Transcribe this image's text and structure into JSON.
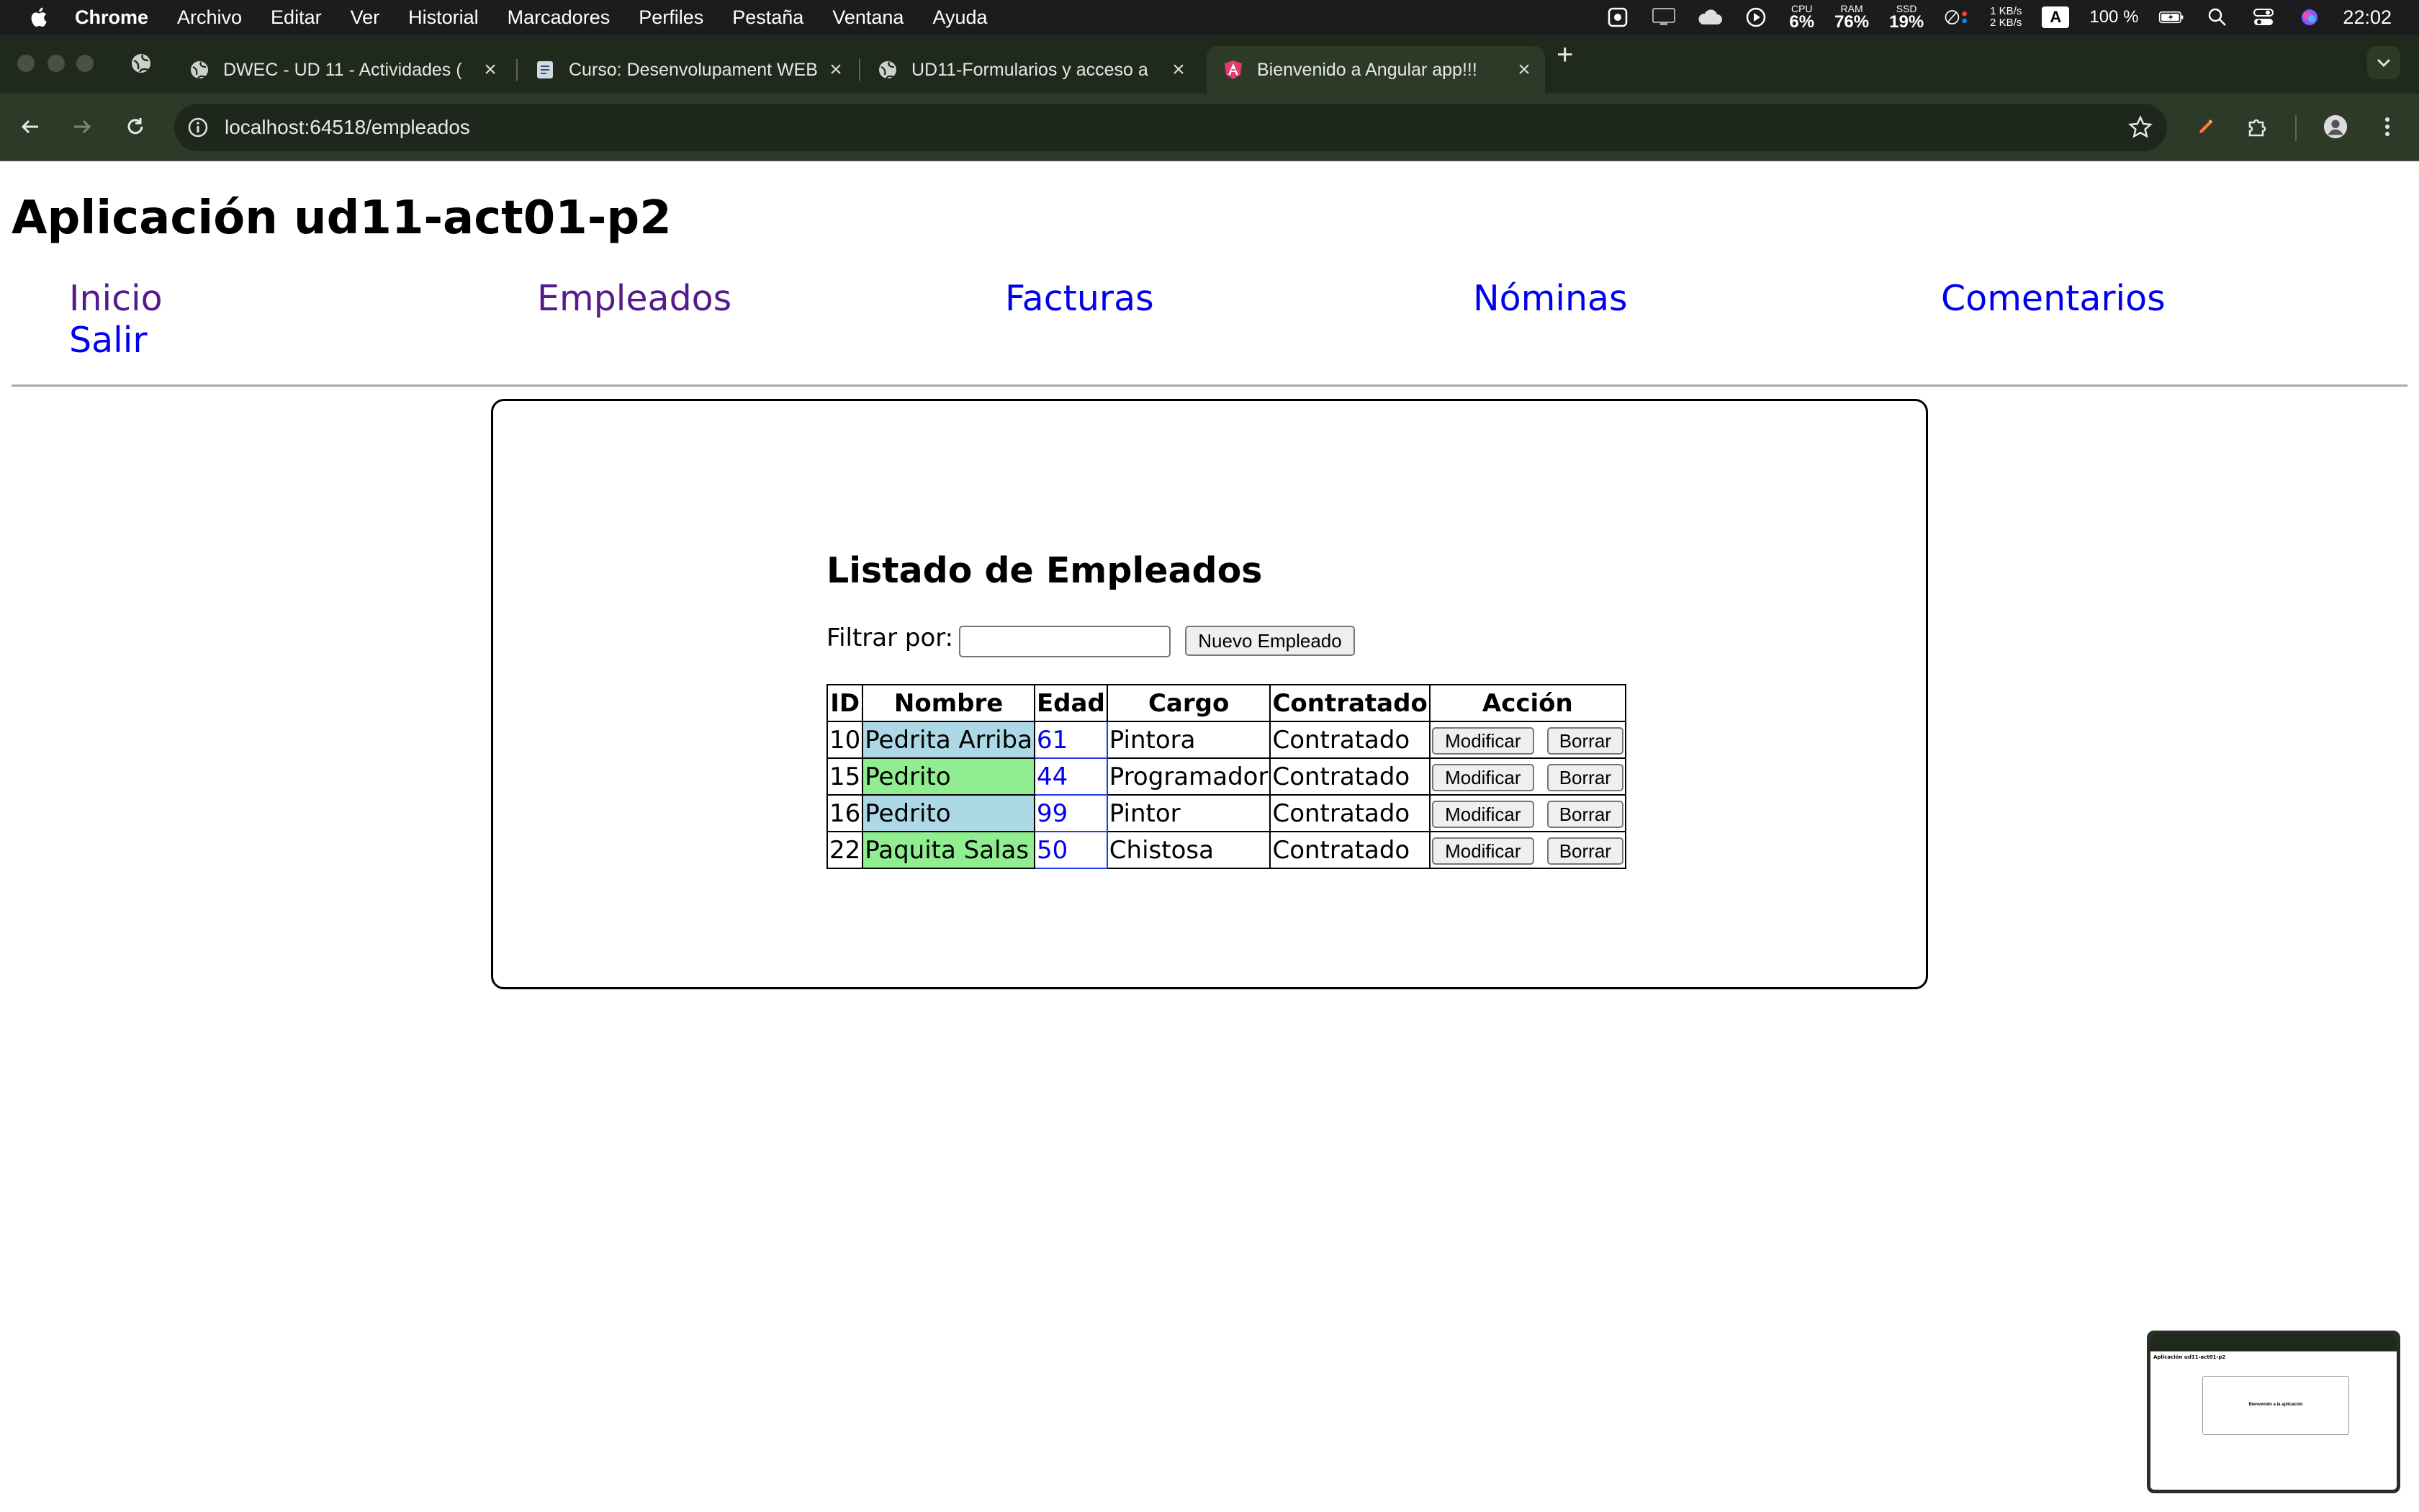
{
  "menubar": {
    "app_name": "Chrome",
    "items": [
      "Archivo",
      "Editar",
      "Ver",
      "Historial",
      "Marcadores",
      "Perfiles",
      "Pestaña",
      "Ventana",
      "Ayuda"
    ],
    "cpu_label": "CPU",
    "cpu_value": "6%",
    "ram_label": "RAM",
    "ram_value": "76%",
    "ssd_label": "SSD",
    "ssd_value": "19%",
    "net_up": "1 KB/s",
    "net_down": "2 KB/s",
    "input_source": "A",
    "battery": "100 %",
    "time": "22:02"
  },
  "tabs": [
    {
      "title": "DWEC - UD 11 - Actividades (",
      "active": false
    },
    {
      "title": "Curso: Desenvolupament WEB",
      "active": false
    },
    {
      "title": "UD11-Formularios y acceso a",
      "active": false
    },
    {
      "title": "Bienvenido a Angular app!!!",
      "active": true
    }
  ],
  "toolbar": {
    "url": "localhost:64518/empleados"
  },
  "app": {
    "title": "Aplicación ud11-act01-p2",
    "nav": [
      "Inicio",
      "Empleados",
      "Facturas",
      "Nóminas",
      "Comentarios",
      "Salir"
    ],
    "list_title": "Listado de Empleados",
    "filter_label": "Filtrar por:",
    "filter_value": "",
    "new_button": "Nuevo Empleado",
    "table": {
      "headers": [
        "ID",
        "Nombre",
        "Edad",
        "Cargo",
        "Contratado",
        "Acción"
      ],
      "rows": [
        {
          "id": "10",
          "nombre": "Pedrita Arriba",
          "edad": "61",
          "cargo": "Pintora",
          "contratado": "Contratado"
        },
        {
          "id": "15",
          "nombre": "Pedrito",
          "edad": "44",
          "cargo": "Programador",
          "contratado": "Contratado"
        },
        {
          "id": "16",
          "nombre": "Pedrito",
          "edad": "99",
          "cargo": "Pintor",
          "contratado": "Contratado"
        },
        {
          "id": "22",
          "nombre": "Paquita Salas",
          "edad": "50",
          "cargo": "Chistosa",
          "contratado": "Contratado"
        }
      ],
      "modify_label": "Modificar",
      "delete_label": "Borrar"
    }
  },
  "thumbnail": {
    "title": "Aplicación ud11-act01-p2",
    "message": "Bienvenido a la aplicación"
  }
}
